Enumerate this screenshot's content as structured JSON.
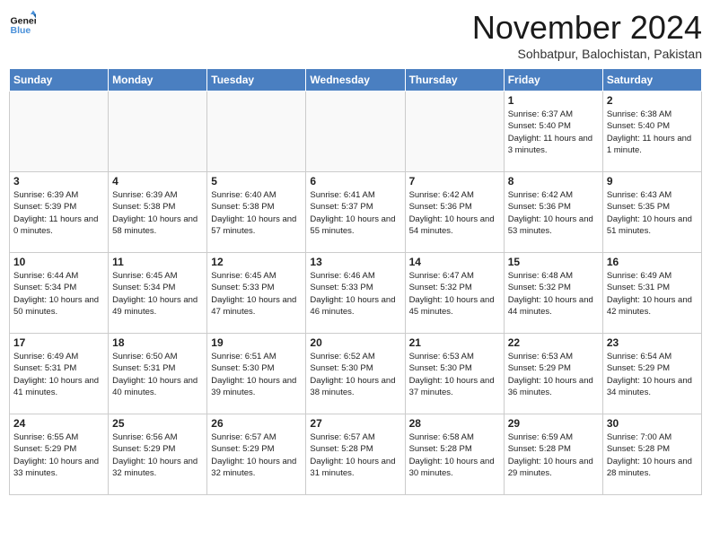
{
  "header": {
    "logo_line1": "General",
    "logo_line2": "Blue",
    "month": "November 2024",
    "location": "Sohbatpur, Balochistan, Pakistan"
  },
  "weekdays": [
    "Sunday",
    "Monday",
    "Tuesday",
    "Wednesday",
    "Thursday",
    "Friday",
    "Saturday"
  ],
  "weeks": [
    [
      {
        "day": "",
        "info": ""
      },
      {
        "day": "",
        "info": ""
      },
      {
        "day": "",
        "info": ""
      },
      {
        "day": "",
        "info": ""
      },
      {
        "day": "",
        "info": ""
      },
      {
        "day": "1",
        "info": "Sunrise: 6:37 AM\nSunset: 5:40 PM\nDaylight: 11 hours\nand 3 minutes."
      },
      {
        "day": "2",
        "info": "Sunrise: 6:38 AM\nSunset: 5:40 PM\nDaylight: 11 hours\nand 1 minute."
      }
    ],
    [
      {
        "day": "3",
        "info": "Sunrise: 6:39 AM\nSunset: 5:39 PM\nDaylight: 11 hours\nand 0 minutes."
      },
      {
        "day": "4",
        "info": "Sunrise: 6:39 AM\nSunset: 5:38 PM\nDaylight: 10 hours\nand 58 minutes."
      },
      {
        "day": "5",
        "info": "Sunrise: 6:40 AM\nSunset: 5:38 PM\nDaylight: 10 hours\nand 57 minutes."
      },
      {
        "day": "6",
        "info": "Sunrise: 6:41 AM\nSunset: 5:37 PM\nDaylight: 10 hours\nand 55 minutes."
      },
      {
        "day": "7",
        "info": "Sunrise: 6:42 AM\nSunset: 5:36 PM\nDaylight: 10 hours\nand 54 minutes."
      },
      {
        "day": "8",
        "info": "Sunrise: 6:42 AM\nSunset: 5:36 PM\nDaylight: 10 hours\nand 53 minutes."
      },
      {
        "day": "9",
        "info": "Sunrise: 6:43 AM\nSunset: 5:35 PM\nDaylight: 10 hours\nand 51 minutes."
      }
    ],
    [
      {
        "day": "10",
        "info": "Sunrise: 6:44 AM\nSunset: 5:34 PM\nDaylight: 10 hours\nand 50 minutes."
      },
      {
        "day": "11",
        "info": "Sunrise: 6:45 AM\nSunset: 5:34 PM\nDaylight: 10 hours\nand 49 minutes."
      },
      {
        "day": "12",
        "info": "Sunrise: 6:45 AM\nSunset: 5:33 PM\nDaylight: 10 hours\nand 47 minutes."
      },
      {
        "day": "13",
        "info": "Sunrise: 6:46 AM\nSunset: 5:33 PM\nDaylight: 10 hours\nand 46 minutes."
      },
      {
        "day": "14",
        "info": "Sunrise: 6:47 AM\nSunset: 5:32 PM\nDaylight: 10 hours\nand 45 minutes."
      },
      {
        "day": "15",
        "info": "Sunrise: 6:48 AM\nSunset: 5:32 PM\nDaylight: 10 hours\nand 44 minutes."
      },
      {
        "day": "16",
        "info": "Sunrise: 6:49 AM\nSunset: 5:31 PM\nDaylight: 10 hours\nand 42 minutes."
      }
    ],
    [
      {
        "day": "17",
        "info": "Sunrise: 6:49 AM\nSunset: 5:31 PM\nDaylight: 10 hours\nand 41 minutes."
      },
      {
        "day": "18",
        "info": "Sunrise: 6:50 AM\nSunset: 5:31 PM\nDaylight: 10 hours\nand 40 minutes."
      },
      {
        "day": "19",
        "info": "Sunrise: 6:51 AM\nSunset: 5:30 PM\nDaylight: 10 hours\nand 39 minutes."
      },
      {
        "day": "20",
        "info": "Sunrise: 6:52 AM\nSunset: 5:30 PM\nDaylight: 10 hours\nand 38 minutes."
      },
      {
        "day": "21",
        "info": "Sunrise: 6:53 AM\nSunset: 5:30 PM\nDaylight: 10 hours\nand 37 minutes."
      },
      {
        "day": "22",
        "info": "Sunrise: 6:53 AM\nSunset: 5:29 PM\nDaylight: 10 hours\nand 36 minutes."
      },
      {
        "day": "23",
        "info": "Sunrise: 6:54 AM\nSunset: 5:29 PM\nDaylight: 10 hours\nand 34 minutes."
      }
    ],
    [
      {
        "day": "24",
        "info": "Sunrise: 6:55 AM\nSunset: 5:29 PM\nDaylight: 10 hours\nand 33 minutes."
      },
      {
        "day": "25",
        "info": "Sunrise: 6:56 AM\nSunset: 5:29 PM\nDaylight: 10 hours\nand 32 minutes."
      },
      {
        "day": "26",
        "info": "Sunrise: 6:57 AM\nSunset: 5:29 PM\nDaylight: 10 hours\nand 32 minutes."
      },
      {
        "day": "27",
        "info": "Sunrise: 6:57 AM\nSunset: 5:28 PM\nDaylight: 10 hours\nand 31 minutes."
      },
      {
        "day": "28",
        "info": "Sunrise: 6:58 AM\nSunset: 5:28 PM\nDaylight: 10 hours\nand 30 minutes."
      },
      {
        "day": "29",
        "info": "Sunrise: 6:59 AM\nSunset: 5:28 PM\nDaylight: 10 hours\nand 29 minutes."
      },
      {
        "day": "30",
        "info": "Sunrise: 7:00 AM\nSunset: 5:28 PM\nDaylight: 10 hours\nand 28 minutes."
      }
    ]
  ]
}
